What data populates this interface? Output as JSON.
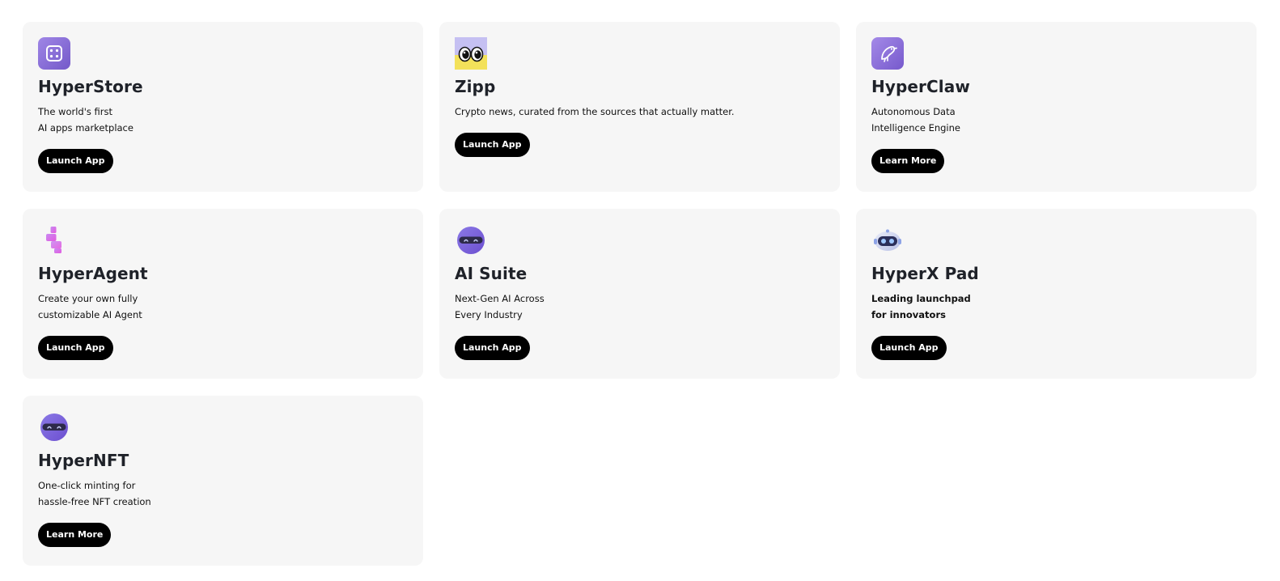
{
  "cards": [
    {
      "title": "HyperStore",
      "desc": [
        "The world's first",
        "AI apps marketplace"
      ],
      "button": "Launch App",
      "icon": "dice-icon"
    },
    {
      "title": "Zipp",
      "desc": [
        "Crypto news, curated from the sources that actually matter."
      ],
      "button": "Launch App",
      "icon": "eyes-icon"
    },
    {
      "title": "HyperClaw",
      "desc": [
        "Autonomous Data",
        "Intelligence Engine"
      ],
      "button": "Learn More",
      "icon": "bird-icon"
    },
    {
      "title": "HyperAgent",
      "desc": [
        "Create your own fully",
        "customizable AI Agent"
      ],
      "button": "Launch App",
      "icon": "agent-icon"
    },
    {
      "title": "AI Suite",
      "desc": [
        "Next-Gen AI Across",
        "Every Industry"
      ],
      "button": "Launch App",
      "icon": "mask-icon"
    },
    {
      "title": "HyperX Pad",
      "desc": [
        "Leading launchpad",
        "for innovators"
      ],
      "button": "Launch App",
      "icon": "robot-icon"
    },
    {
      "title": "HyperNFT",
      "desc": [
        "One-click minting for",
        "hassle-free NFT creation"
      ],
      "button": "Learn More",
      "icon": "mask-icon"
    }
  ],
  "colors": {
    "card_bg": "#f6f6f6",
    "button_bg": "#000000",
    "button_text": "#ffffff",
    "brand_purple": "#8a6bd6"
  }
}
